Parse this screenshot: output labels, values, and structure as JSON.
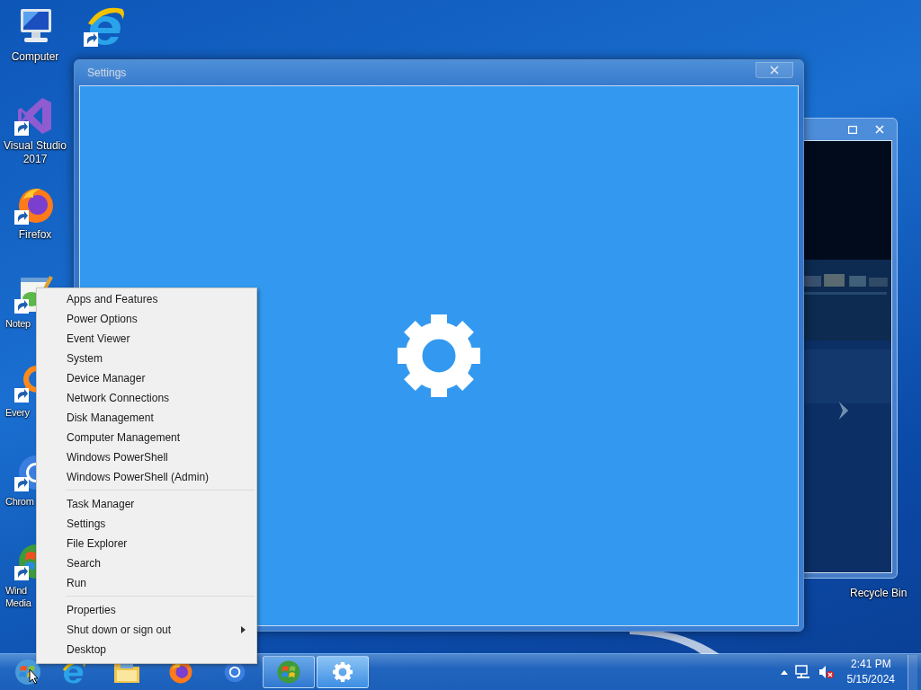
{
  "desktop_icons": [
    {
      "kind": "computer",
      "label": "Computer"
    },
    {
      "kind": "vs",
      "label": "Visual Studio 2017"
    },
    {
      "kind": "firefox",
      "label": "Firefox"
    },
    {
      "kind": "notepad",
      "label": "Notep"
    },
    {
      "kind": "everything",
      "label": "Every"
    },
    {
      "kind": "chrome",
      "label": "Chrom"
    },
    {
      "kind": "media",
      "label": "Wind Media"
    }
  ],
  "corner_icon": {
    "kind": "ie"
  },
  "recycle_bin": {
    "label": "Recycle Bin"
  },
  "settings_window": {
    "title": "Settings"
  },
  "context_menu": {
    "groups": [
      [
        {
          "label": "Apps and Features",
          "submenu": false
        },
        {
          "label": "Power Options",
          "submenu": false
        },
        {
          "label": "Event Viewer",
          "submenu": false
        },
        {
          "label": "System",
          "submenu": false
        },
        {
          "label": "Device Manager",
          "submenu": false
        },
        {
          "label": "Network Connections",
          "submenu": false
        },
        {
          "label": "Disk Management",
          "submenu": false
        },
        {
          "label": "Computer Management",
          "submenu": false
        },
        {
          "label": "Windows PowerShell",
          "submenu": false
        },
        {
          "label": "Windows PowerShell (Admin)",
          "submenu": false
        }
      ],
      [
        {
          "label": "Task Manager",
          "submenu": false
        },
        {
          "label": "Settings",
          "submenu": false
        },
        {
          "label": "File Explorer",
          "submenu": false
        },
        {
          "label": "Search",
          "submenu": false
        },
        {
          "label": "Run",
          "submenu": false
        }
      ],
      [
        {
          "label": "Properties",
          "submenu": false
        },
        {
          "label": "Shut down or sign out",
          "submenu": true
        },
        {
          "label": "Desktop",
          "submenu": false
        }
      ]
    ]
  },
  "taskbar": {
    "items": [
      {
        "kind": "ie",
        "running": false,
        "selected": false
      },
      {
        "kind": "explorer",
        "running": false,
        "selected": false
      },
      {
        "kind": "firefox",
        "running": false,
        "selected": false
      },
      {
        "kind": "chrome",
        "running": false,
        "selected": false
      },
      {
        "kind": "media",
        "running": true,
        "selected": false
      },
      {
        "kind": "settings",
        "running": true,
        "selected": true
      }
    ],
    "time": "2:41 PM",
    "date": "5/15/2024"
  }
}
